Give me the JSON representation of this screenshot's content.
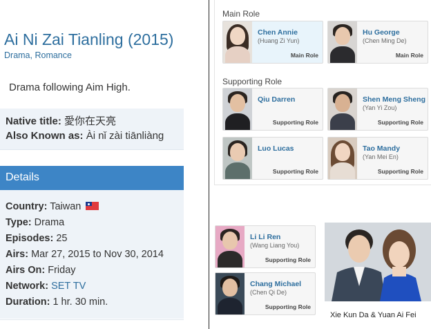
{
  "drama": {
    "title": "Ai Ni Zai Tianling (2015)",
    "genres": [
      "Drama",
      "Romance"
    ],
    "genre_separator": ", ",
    "synopsis": "Drama following Aim High."
  },
  "names": {
    "native_label": "Native title:",
    "native_value": "愛你在天亮",
    "aka_label": "Also Known as:",
    "aka_value": "Ài nǐ zài tiānliàng"
  },
  "details": {
    "header": "Details",
    "country_label": "Country:",
    "country_value": "Taiwan",
    "country_flag_icon": "taiwan-flag-icon",
    "type_label": "Type:",
    "type_value": "Drama",
    "episodes_label": "Episodes:",
    "episodes_value": "25",
    "airs_label": "Airs:",
    "airs_value": "Mar 27, 2015 to Nov 30, 2014",
    "airs_on_label": "Airs On:",
    "airs_on_value": "Friday",
    "network_label": "Network:",
    "network_value": "SET TV",
    "duration_label": "Duration:",
    "duration_value": "1 hr. 30 min."
  },
  "cast": {
    "main_label": "Main Role",
    "supporting_label": "Supporting Role",
    "main": [
      {
        "name": "Chen Annie",
        "native": "(Huang Zi Yun)",
        "role": "Main Role",
        "highlighted": true
      },
      {
        "name": "Hu George",
        "native": "(Chen Ming De)",
        "role": "Main Role",
        "highlighted": false
      }
    ],
    "supporting": [
      {
        "name": "Qiu Darren",
        "native": "",
        "role": "Supporting Role"
      },
      {
        "name": "Shen Meng Sheng",
        "native": "(Yan Yi Zou)",
        "role": "Supporting Role"
      },
      {
        "name": "Luo Lucas",
        "native": "",
        "role": "Supporting Role"
      },
      {
        "name": "Tao Mandy",
        "native": "(Yan Mei En)",
        "role": "Supporting Role"
      }
    ],
    "extra": [
      {
        "name": "Li Li Ren",
        "native": "(Wang Liang You)",
        "role": "Supporting Role"
      },
      {
        "name": "Chang Michael",
        "native": "(Chen Qi De)",
        "role": "Supporting Role"
      }
    ]
  },
  "photo_caption": "Xie Kun Da & Yuan Ai Fei",
  "colors": {
    "link": "#2d6e9e",
    "details_bar": "#3d85c6",
    "panel_bg": "#eef3f8"
  }
}
